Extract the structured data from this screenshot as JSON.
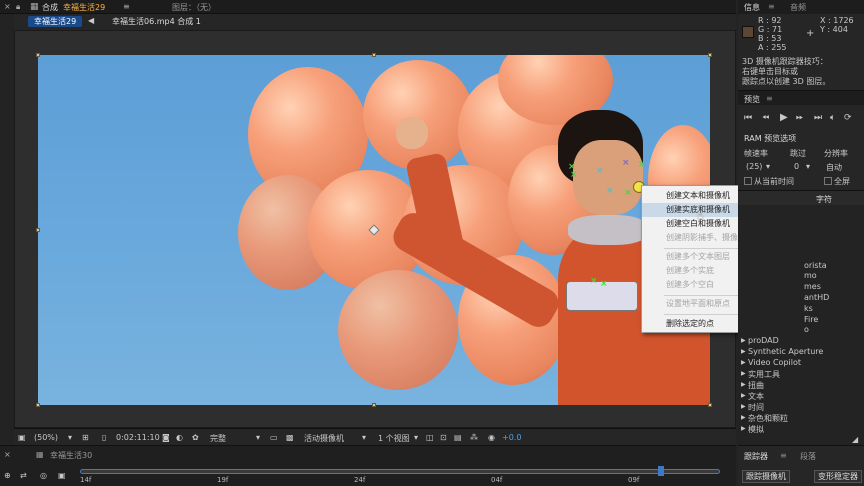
{
  "top_tab": {
    "close": "×",
    "panel": "合成",
    "active_comp": "幸福生活29",
    "menu_glyph": "≡",
    "layer_label": "图层：（无）"
  },
  "sub_tabs": [
    "幸福生活29",
    "幸福生活06.mp4 合成 1"
  ],
  "info_panel": {
    "tabs": [
      "信息",
      "音频"
    ],
    "r": "R : 92",
    "g": "G : 71",
    "b": "B : 53",
    "a": "A : 255",
    "swatch_color": "#5c4735",
    "x": "X : 1726",
    "y": "Y : 404",
    "tip_lines": [
      "3D 摄像机跟踪器技巧：",
      "右键单击目标或",
      "跟踪点以创建 3D 图层。"
    ]
  },
  "preview_panel": {
    "tab": "预览",
    "ram_title": "RAM 预览选项",
    "headers": [
      "帧速率",
      "跳过",
      "分辨率"
    ],
    "values": [
      "(25)",
      "0",
      "自动"
    ],
    "from_current": "从当前时间",
    "fullscreen": "全屏"
  },
  "effects_panel": {
    "tab_partial": "字符",
    "partial_items": [
      "orista",
      "mo",
      "mes",
      "antHD",
      "ks",
      "Fire",
      "o"
    ],
    "categories": [
      "proDAD",
      "Synthetic Aperture",
      "Video Copilot",
      "实用工具",
      "扭曲",
      "文本",
      "时间",
      "杂色和颗粒",
      "模拟"
    ]
  },
  "context_menu": {
    "items": [
      {
        "label": "创建文本和摄像机",
        "enabled": true
      },
      {
        "label": "创建实底和摄像机",
        "enabled": true,
        "highlighted": true
      },
      {
        "label": "创建空白和摄像机",
        "enabled": true
      },
      {
        "label": "创建阴影捕手、摄像机和光",
        "enabled": false
      },
      {
        "label": "创建多个文本图层",
        "enabled": false
      },
      {
        "label": "创建多个实底",
        "enabled": false
      },
      {
        "label": "创建多个空白",
        "enabled": false
      },
      {
        "label": "设置地平面和原点",
        "enabled": false
      },
      {
        "label": "删除选定的点",
        "enabled": true
      }
    ]
  },
  "viewer_toolbar": {
    "zoom": "(50%)",
    "timecode": "0:02:11:10",
    "resolution": "完整",
    "camera": "活动摄像机",
    "views": "1 个视图",
    "exposure": "+0.0"
  },
  "timeline": {
    "comp_tab": "幸福生活30",
    "ticks": [
      "14f",
      "19f",
      "24f",
      "04f",
      "09f"
    ]
  },
  "tracker_panel": {
    "tabs": [
      "跟踪器",
      "段落"
    ],
    "track_camera": "跟踪摄像机",
    "warp_stabilizer": "变形稳定器"
  },
  "colors": {
    "accent_orange": "#ffb23f",
    "active_tab_blue": "#1b4a8a",
    "track_green": "#3ddc3d",
    "track_cyan": "#3fc6d6",
    "track_purple": "#7a66e0"
  }
}
